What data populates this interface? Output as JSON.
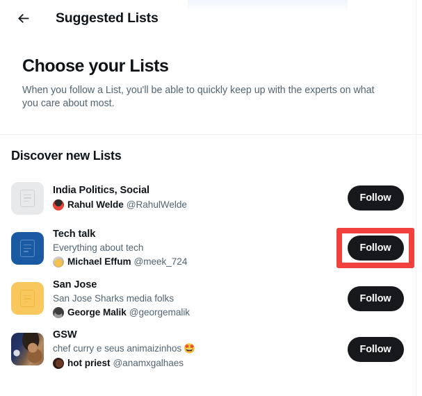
{
  "header": {
    "back_icon": "arrow-left-icon",
    "title": "Suggested Lists"
  },
  "intro": {
    "title": "Choose your Lists",
    "subtitle": "When you follow a List, you'll be able to quickly keep up with the experts on what you care about most."
  },
  "section": {
    "title": "Discover new Lists"
  },
  "colors": {
    "follow_button_bg": "#16181c",
    "follow_button_text": "#ffffff",
    "highlight_border": "#f2403c",
    "muted_text": "#536471",
    "primary_text": "#0f1419",
    "divider": "#eff3f4",
    "thumb_placeholder": "#e7e9ea",
    "thumb_blue": "#1a5aa3",
    "thumb_yellow": "#f8c85e"
  },
  "lists": [
    {
      "name": "India Politics, Social",
      "description": "",
      "owner_name": "Rahul Welde",
      "owner_handle": "@RahulWelde",
      "owner_avatar": "rahul-welde-avatar",
      "emoji": "",
      "thumb_type": "placeholder-glyph",
      "thumb_icon": "list-placeholder-icon",
      "thumb_bg": "#e7e9ea",
      "thumb_glyph_color": "#cfd3d6",
      "follow_label": "Follow",
      "highlighted": false
    },
    {
      "name": "Tech talk",
      "description": "Everything about tech",
      "owner_name": "Michael Effum",
      "owner_handle": "@meek_724",
      "owner_avatar": "michael-effum-avatar",
      "emoji": "",
      "thumb_type": "color-glyph",
      "thumb_icon": "list-placeholder-icon",
      "thumb_bg": "#1a5aa3",
      "thumb_glyph_color": "#5b8dc4",
      "follow_label": "Follow",
      "highlighted": true
    },
    {
      "name": "San Jose",
      "description": "San Jose Sharks media folks",
      "owner_name": "George Malik",
      "owner_handle": "@georgemalik",
      "owner_avatar": "george-malik-avatar",
      "emoji": "",
      "thumb_type": "color-glyph",
      "thumb_icon": "list-placeholder-icon",
      "thumb_bg": "#f8c85e",
      "thumb_glyph_color": "#f0b93f",
      "follow_label": "Follow",
      "highlighted": false
    },
    {
      "name": "GSW",
      "description": "chef curry e seus animaizinhos",
      "owner_name": "hot priest",
      "owner_handle": "@anamxgalhaes",
      "owner_avatar": "hot-priest-avatar",
      "emoji": "🤩",
      "thumb_type": "photo",
      "thumb_icon": "",
      "thumb_bg": "",
      "thumb_glyph_color": "",
      "follow_label": "Follow",
      "highlighted": false
    }
  ]
}
